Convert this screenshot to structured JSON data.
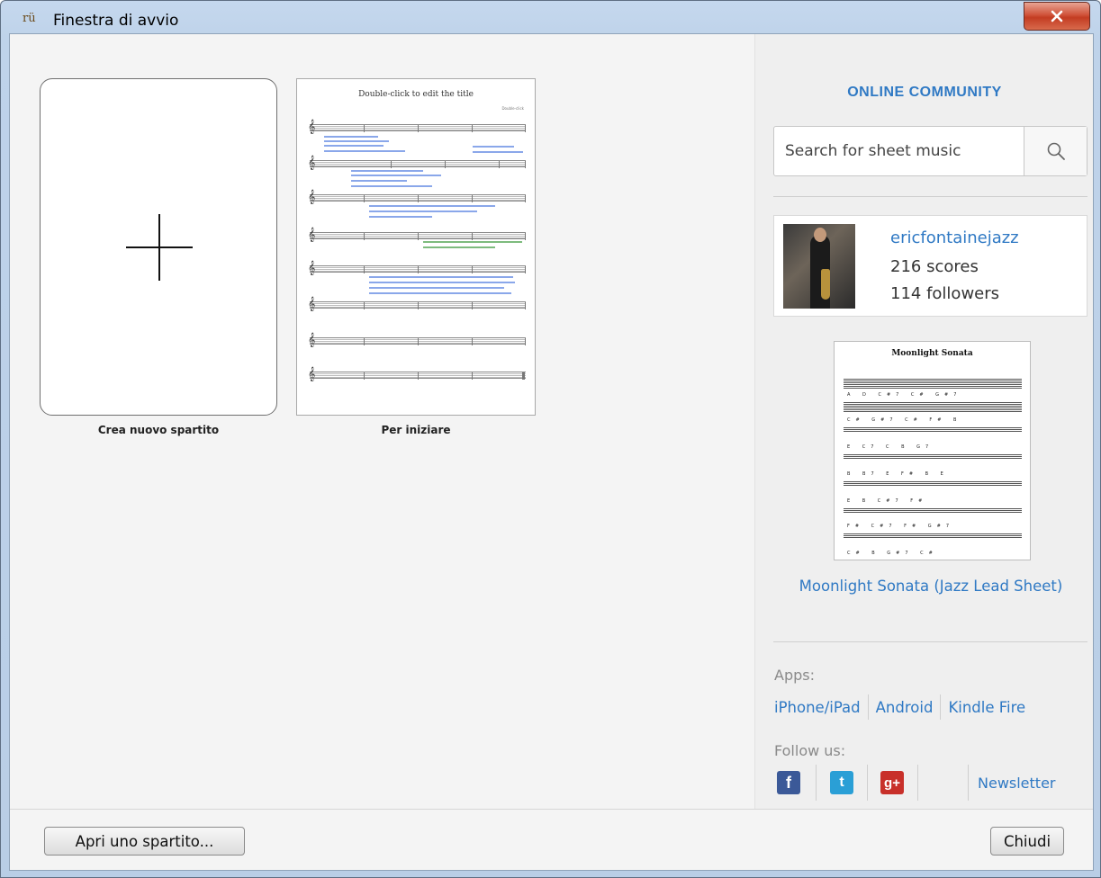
{
  "window": {
    "title": "Finestra di avvio",
    "app_icon": "rü"
  },
  "templates": [
    {
      "label": "Crea nuovo spartito",
      "icon": "plus-icon"
    },
    {
      "label": "Per iniziare",
      "thumbnail_title": "Double-click to edit the title",
      "thumbnail_composer": "Double-click"
    }
  ],
  "community": {
    "title": "ONLINE COMMUNITY",
    "search_placeholder": "Search for sheet music",
    "user": {
      "name": "ericfontainejazz",
      "scores": "216 scores",
      "followers": "114 followers"
    },
    "featured_score": {
      "thumbnail_title": "Moonlight Sonata",
      "title": "Moonlight Sonata (Jazz Lead Sheet)"
    },
    "apps_label": "Apps:",
    "apps": [
      "iPhone/iPad",
      "Android",
      "Kindle Fire"
    ],
    "follow_label": "Follow us:",
    "social": [
      {
        "name": "facebook-icon",
        "glyph": "f",
        "color": "#3b5998"
      },
      {
        "name": "twitter-icon",
        "glyph": "t",
        "color": "#2a9fd6"
      },
      {
        "name": "google-plus-icon",
        "glyph": "g+",
        "color": "#c8302a"
      }
    ],
    "newsletter": "Newsletter"
  },
  "footer": {
    "open_button": "Apri uno spartito...",
    "close_button": "Chiudi"
  }
}
